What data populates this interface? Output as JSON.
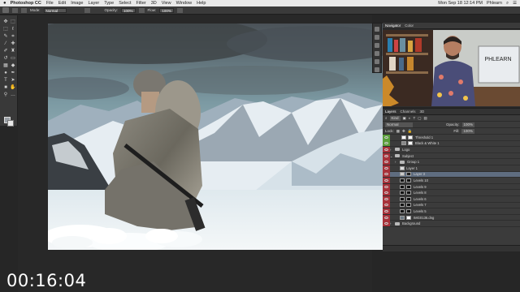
{
  "menubar": {
    "app_name": "Photoshop CC",
    "items": [
      "File",
      "Edit",
      "Image",
      "Layer",
      "Type",
      "Select",
      "Filter",
      "3D",
      "View",
      "Window",
      "Help"
    ],
    "clock": "Mon Sep 18 12:14 PM",
    "user": "Phlearn"
  },
  "options_bar": {
    "mode_label": "Mode:",
    "mode_value": "Normal",
    "opacity_label": "Opacity:",
    "opacity_value": "100%",
    "flow_label": "Flow:",
    "flow_value": "100%"
  },
  "nav_panel": {
    "tabs": [
      "Navigator",
      "Color"
    ],
    "webcam_sign": "PHLEARN"
  },
  "layers_panel": {
    "tabs": [
      "Layers",
      "Channels",
      "3D"
    ],
    "kind_label": "Kind",
    "blend_mode": "Normal",
    "opacity_label": "Opacity:",
    "opacity_value": "100%",
    "lock_label": "Lock:",
    "fill_label": "Fill:",
    "fill_value": "100%",
    "layers": [
      {
        "name": "Threshold 1",
        "type": "adjustment",
        "eye": "green"
      },
      {
        "name": "Black & White 1",
        "type": "adjustment",
        "eye": "green"
      },
      {
        "name": "Logo",
        "type": "group",
        "eye": "red"
      },
      {
        "name": "Subject",
        "type": "group",
        "eye": "red"
      },
      {
        "name": "Group 1",
        "type": "group",
        "eye": "red"
      },
      {
        "name": "Layer 1",
        "type": "pixel",
        "eye": "red"
      },
      {
        "name": "Layer 3",
        "type": "pixel",
        "eye": "red",
        "selected": true
      },
      {
        "name": "Levels 10",
        "type": "adjustment",
        "eye": "red"
      },
      {
        "name": "Levels 9",
        "type": "adjustment",
        "eye": "red"
      },
      {
        "name": "Levels 8",
        "type": "adjustment",
        "eye": "red"
      },
      {
        "name": "Levels 6",
        "type": "adjustment",
        "eye": "red"
      },
      {
        "name": "Levels 7",
        "type": "adjustment",
        "eye": "red"
      },
      {
        "name": "Levels 5",
        "type": "adjustment",
        "eye": "red"
      },
      {
        "name": "IMG0136.dng",
        "type": "smart",
        "eye": "red"
      },
      {
        "name": "Background",
        "type": "group",
        "eye": "red"
      }
    ]
  },
  "timecode": "00:16:04",
  "colors": {
    "eye_green": "#5a9e3a",
    "eye_red": "#a8323a",
    "selected_layer": "#5f6d80"
  }
}
